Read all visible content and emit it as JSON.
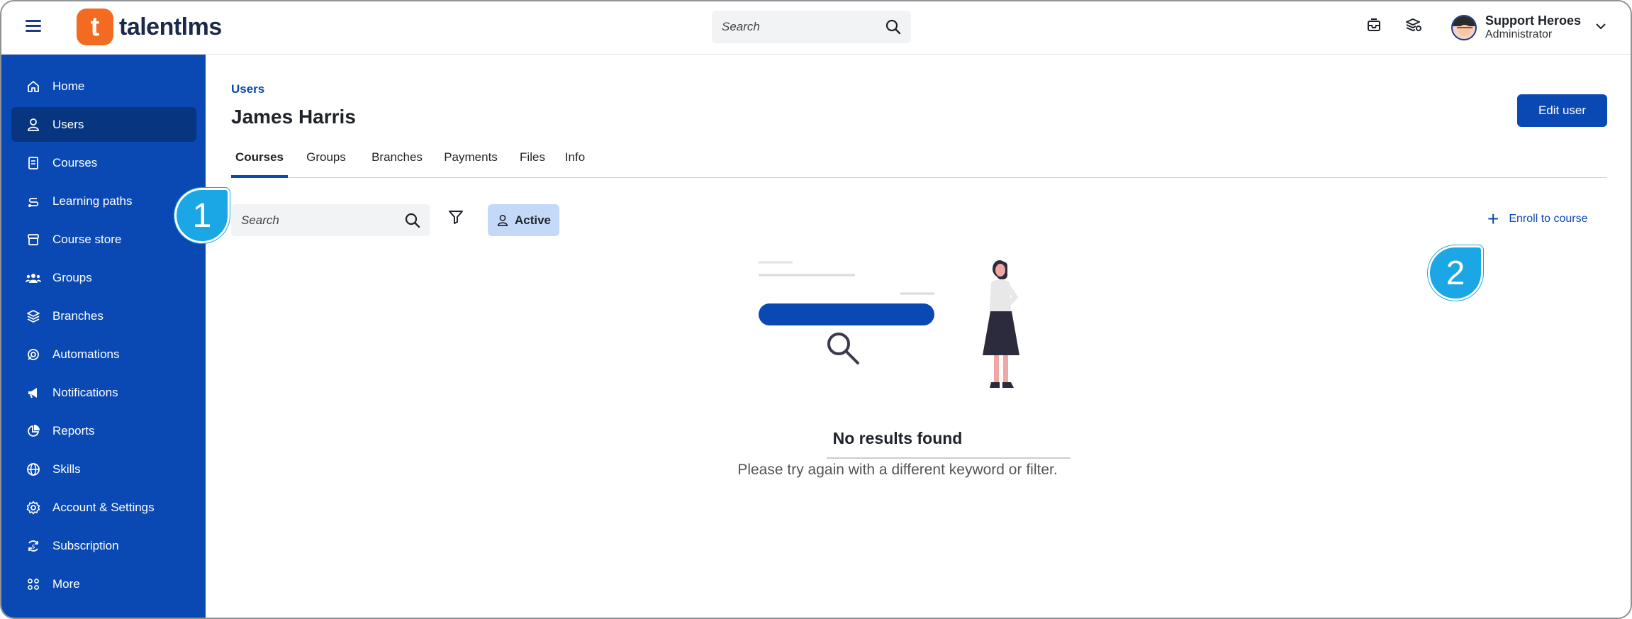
{
  "brand": {
    "name": "talentlms",
    "mark": "t",
    "color": "#f36b21"
  },
  "header": {
    "search_placeholder": "Search",
    "user": {
      "name": "Support Heroes",
      "role": "Administrator"
    }
  },
  "sidebar": {
    "items": [
      {
        "label": "Home",
        "icon": "home-icon"
      },
      {
        "label": "Users",
        "icon": "user-icon",
        "active": true
      },
      {
        "label": "Courses",
        "icon": "book-icon"
      },
      {
        "label": "Learning paths",
        "icon": "path-icon"
      },
      {
        "label": "Course store",
        "icon": "store-icon"
      },
      {
        "label": "Groups",
        "icon": "groups-icon"
      },
      {
        "label": "Branches",
        "icon": "layers-icon"
      },
      {
        "label": "Automations",
        "icon": "automation-icon"
      },
      {
        "label": "Notifications",
        "icon": "megaphone-icon"
      },
      {
        "label": "Reports",
        "icon": "pie-chart-icon"
      },
      {
        "label": "Skills",
        "icon": "globe-icon"
      },
      {
        "label": "Account & Settings",
        "icon": "gear-icon"
      },
      {
        "label": "Subscription",
        "icon": "subscription-icon"
      },
      {
        "label": "More",
        "icon": "grid-icon"
      }
    ]
  },
  "main": {
    "breadcrumb": "Users",
    "title": "James Harris",
    "edit_button": "Edit user",
    "tabs": [
      {
        "label": "Courses",
        "active": true
      },
      {
        "label": "Groups"
      },
      {
        "label": "Branches"
      },
      {
        "label": "Payments"
      },
      {
        "label": "Files"
      },
      {
        "label": "Info"
      }
    ],
    "search_placeholder": "Search",
    "status_filter": "Active",
    "enroll_label": "Enroll to course",
    "empty_title": "No results found",
    "empty_subtitle": "Please try again with a different keyword or filter."
  },
  "callouts": [
    "1",
    "2"
  ],
  "colors": {
    "primary": "#0a49b3",
    "sidebar_active": "#083580",
    "chip": "#c3d9f7",
    "callout": "#1ba6e5"
  }
}
